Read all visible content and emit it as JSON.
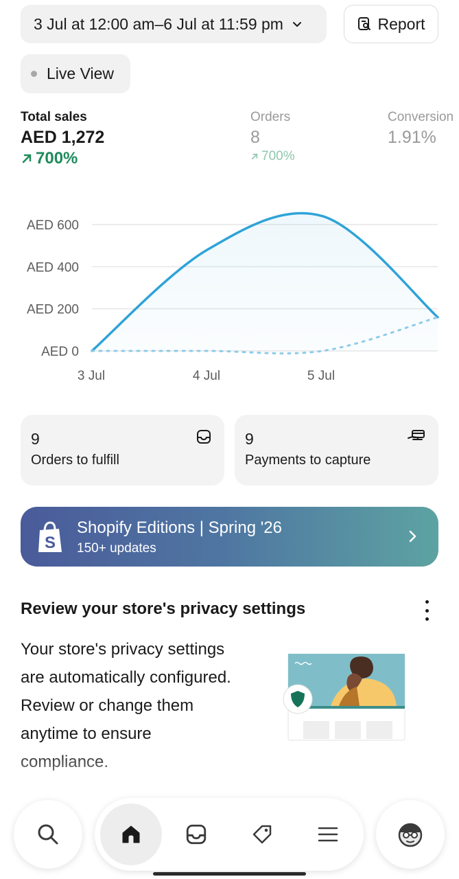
{
  "header": {
    "date_range": "3 Jul at 12:00 am–6 Jul at 11:59 pm",
    "report_label": "Report",
    "live_view_label": "Live View"
  },
  "metrics": {
    "total_sales": {
      "label": "Total sales",
      "value": "AED 1,272",
      "change": "700%"
    },
    "orders": {
      "label": "Orders",
      "value": "8",
      "change": "700%"
    },
    "conversion": {
      "label": "Conversion",
      "value": "1.91%"
    }
  },
  "chart_data": {
    "type": "line",
    "x": [
      "3 Jul",
      "4 Jul",
      "5 Jul"
    ],
    "y_ticks": [
      "AED 600",
      "AED 400",
      "AED 200",
      "AED 0"
    ],
    "ylim": [
      0,
      600
    ],
    "series": [
      {
        "style": "solid",
        "color": "#2ea3d8",
        "values": [
          0,
          480,
          640,
          160
        ]
      },
      {
        "style": "dashed",
        "color": "#8fcbe8",
        "values": [
          0,
          0,
          0,
          160
        ]
      }
    ]
  },
  "cards": [
    {
      "count": "9",
      "label": "Orders to fulfill",
      "icon": "inbox-icon"
    },
    {
      "count": "9",
      "label": "Payments to capture",
      "icon": "payment-hand-icon"
    }
  ],
  "banner": {
    "title": "Shopify Editions | Spring '26",
    "subtitle": "150+ updates"
  },
  "privacy": {
    "title": "Review your store's privacy settings",
    "body": "Your store's privacy settings are automatically configured. Review or change them anytime to ensure compliance."
  },
  "nav": {
    "items": [
      "search-icon",
      "home-icon",
      "inbox-icon",
      "tag-icon",
      "menu-icon",
      "avatar-icon"
    ]
  },
  "colors": {
    "accent_green": "#1f8a5b",
    "chart_line": "#2ea3d8",
    "banner_start": "#4a5b9a",
    "banner_end": "#5da3a2"
  }
}
